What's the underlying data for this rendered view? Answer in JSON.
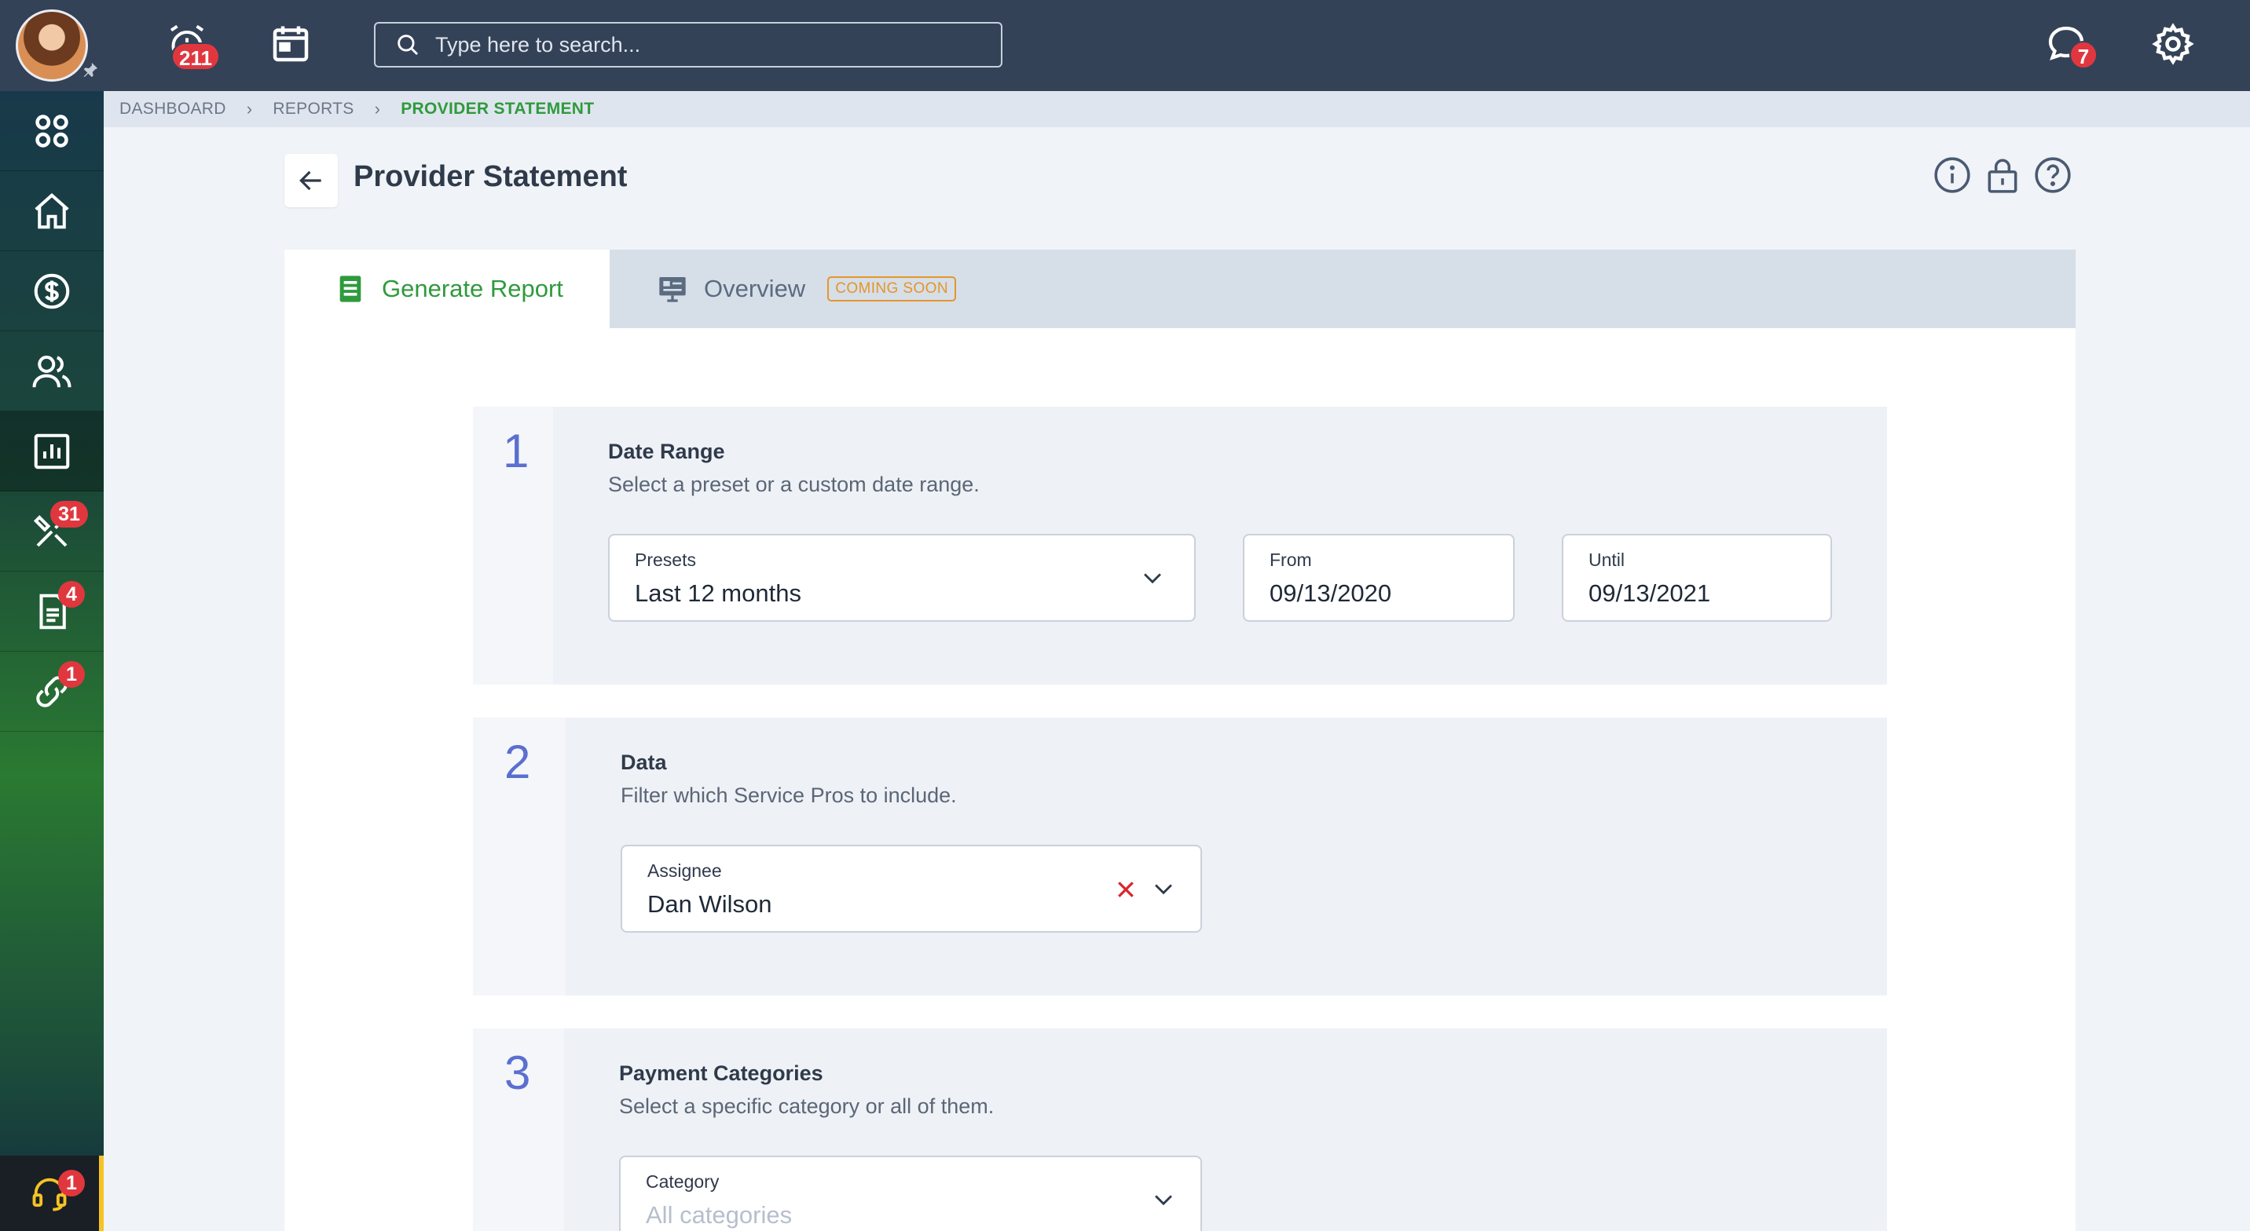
{
  "header": {
    "search_placeholder": "Type here to search...",
    "alarm_badge": "211",
    "chat_badge": "7"
  },
  "sidebar": {
    "items": [
      {
        "icon": "apps-grid-icon"
      },
      {
        "icon": "home-icon"
      },
      {
        "icon": "dollar-icon"
      },
      {
        "icon": "users-icon"
      },
      {
        "icon": "reports-chart-icon",
        "active": true
      },
      {
        "icon": "tools-icon",
        "badge": "31"
      },
      {
        "icon": "document-icon",
        "badge": "4"
      },
      {
        "icon": "link-icon",
        "badge": "1"
      }
    ],
    "support_badge": "1"
  },
  "breadcrumb": {
    "items": [
      "DASHBOARD",
      "REPORTS",
      "PROVIDER STATEMENT"
    ]
  },
  "page": {
    "title": "Provider Statement"
  },
  "tabs": {
    "generate": "Generate Report",
    "overview": "Overview",
    "coming_soon": "COMING SOON"
  },
  "steps": {
    "date_range": {
      "number": "1",
      "title": "Date Range",
      "description": "Select a preset or a custom date range.",
      "presets_label": "Presets",
      "presets_value": "Last 12 months",
      "from_label": "From",
      "from_value": "09/13/2020",
      "until_label": "Until",
      "until_value": "09/13/2021"
    },
    "data": {
      "number": "2",
      "title": "Data",
      "description": "Filter which Service Pros to include.",
      "assignee_label": "Assignee",
      "assignee_value": "Dan Wilson"
    },
    "payment": {
      "number": "3",
      "title": "Payment Categories",
      "description": "Select a specific category or all of them.",
      "category_label": "Category",
      "category_placeholder": "All categories"
    }
  },
  "colors": {
    "topbar": "#344258",
    "accent_green": "#2f9a3d",
    "step_number": "#5a6fd0",
    "badge_red": "#e0373f",
    "coming_soon": "#e59627"
  }
}
